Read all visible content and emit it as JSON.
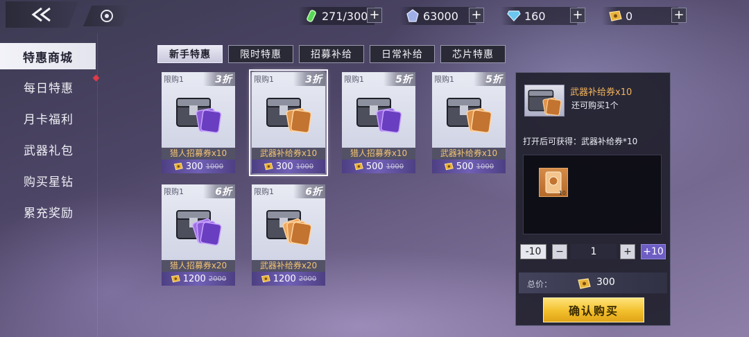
{
  "resources": {
    "stamina": {
      "value": "271/300",
      "icon": "green-vial-icon"
    },
    "crystal": {
      "value": "63000",
      "icon": "crystal-icon"
    },
    "diamond": {
      "value": "160",
      "icon": "diamond-icon"
    },
    "ticket": {
      "value": "0",
      "icon": "gold-ticket-icon"
    },
    "plus_label": "+"
  },
  "sidebar": {
    "items": [
      {
        "label": "特惠商城"
      },
      {
        "label": "每日特惠"
      },
      {
        "label": "月卡福利"
      },
      {
        "label": "武器礼包"
      },
      {
        "label": "购买星钻"
      },
      {
        "label": "累充奖励"
      }
    ]
  },
  "tabs": [
    {
      "label": "新手特惠"
    },
    {
      "label": "限时特惠"
    },
    {
      "label": "招募补给"
    },
    {
      "label": "日常补给"
    },
    {
      "label": "芯片特惠"
    }
  ],
  "products": [
    {
      "limit": "限购1",
      "discount": "3折",
      "name": "猎人招募券x10",
      "price": "300",
      "original": "1000",
      "variant": "purple"
    },
    {
      "limit": "限购1",
      "discount": "3折",
      "name": "武器补给券x10",
      "price": "300",
      "original": "1000",
      "variant": "orange"
    },
    {
      "limit": "限购1",
      "discount": "5折",
      "name": "猎人招募券x10",
      "price": "500",
      "original": "1000",
      "variant": "purple"
    },
    {
      "limit": "限购1",
      "discount": "5折",
      "name": "武器补给券x10",
      "price": "500",
      "original": "1000",
      "variant": "orange"
    },
    {
      "limit": "限购1",
      "discount": "6折",
      "name": "猎人招募券x20",
      "price": "1200",
      "original": "2000",
      "variant": "purple"
    },
    {
      "limit": "限购1",
      "discount": "6折",
      "name": "武器补给券x20",
      "price": "1200",
      "original": "2000",
      "variant": "orange"
    }
  ],
  "detail": {
    "name": "武器补给券x10",
    "limit_text": "还可购买1个",
    "contents_text": "打开后可获得：武器补给券*10",
    "item_count": "10",
    "minus10": "-10",
    "minus": "−",
    "quantity": "1",
    "plus": "+",
    "plus10": "+10",
    "total_label": "总价：",
    "total_value": "300",
    "confirm_label": "确认购买"
  },
  "colors": {
    "accent_gold": "#f2c02c",
    "price_bar": "#6d5ec4",
    "name_orange": "#f2b45c"
  }
}
